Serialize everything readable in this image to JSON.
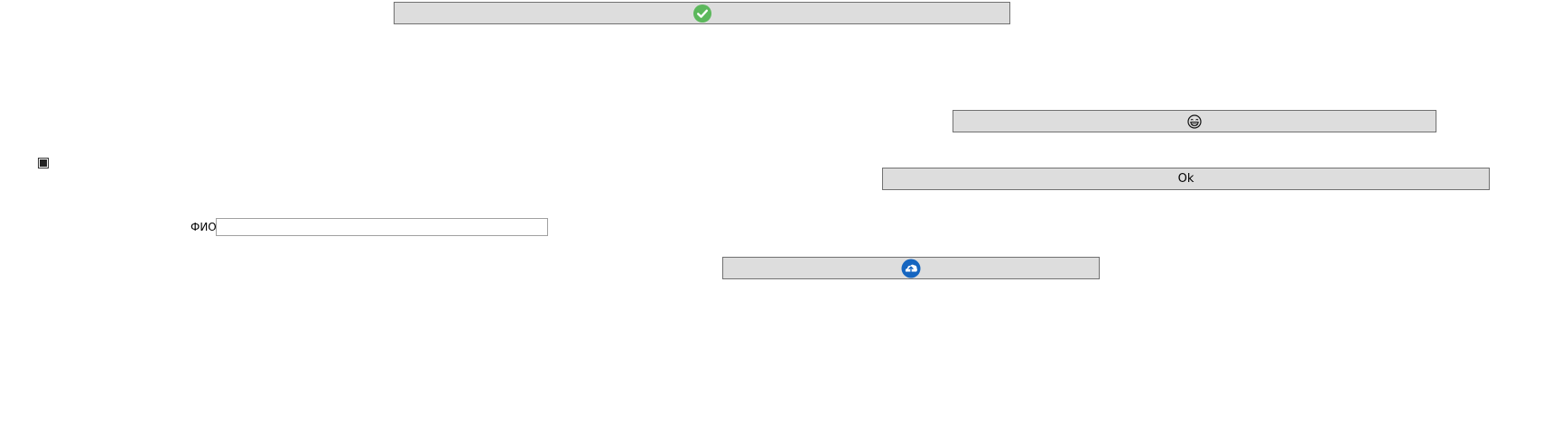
{
  "buttons": {
    "check": {
      "icon": "check-circle-icon",
      "color": "#5cb85c"
    },
    "face": {
      "icon": "grinning-face-icon"
    },
    "ok": {
      "label": "Ok"
    },
    "cloud": {
      "icon": "cloud-upload-icon",
      "color": "#1565c0"
    }
  },
  "checkbox": {
    "checked": true
  },
  "fio_field": {
    "label": "ФИО",
    "value": "",
    "placeholder": ""
  }
}
